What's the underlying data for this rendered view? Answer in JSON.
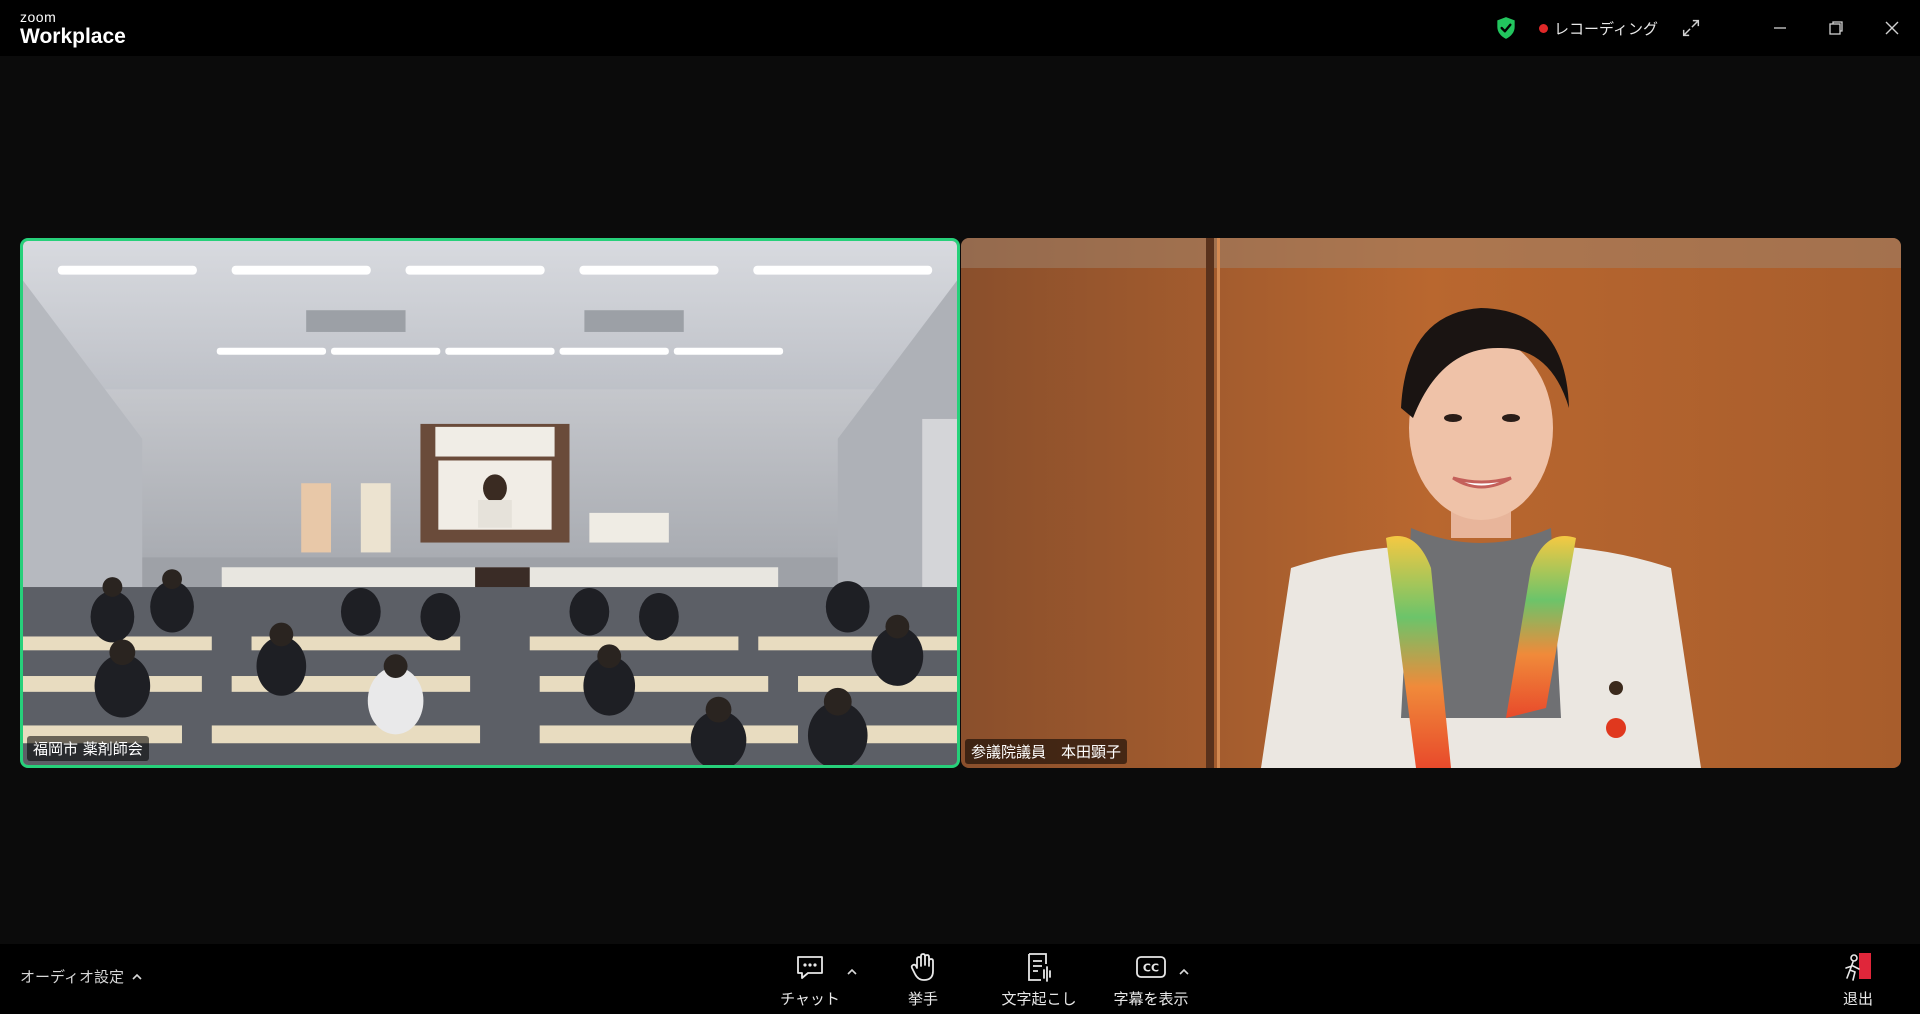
{
  "app": {
    "brand_small": "zoom",
    "brand_big": "Workplace"
  },
  "titlebar": {
    "recording_label": "レコーディング",
    "icons": [
      "encryption-shield-icon",
      "recording-dot-icon",
      "fullscreen-icon",
      "minimize-icon",
      "restore-icon",
      "close-icon"
    ],
    "accent_color": "#27d07a",
    "recording_color": "#e02828"
  },
  "participants": [
    {
      "name": "福岡市 薬剤師会",
      "active_speaker": true
    },
    {
      "name": "参議院議員　本田顕子",
      "active_speaker": false
    }
  ],
  "toolbar": {
    "audio_settings_label": "オーディオ設定",
    "chat_label": "チャット",
    "raise_hand_label": "挙手",
    "transcript_label": "文字起こし",
    "captions_label": "字幕を表示",
    "leave_label": "退出"
  }
}
